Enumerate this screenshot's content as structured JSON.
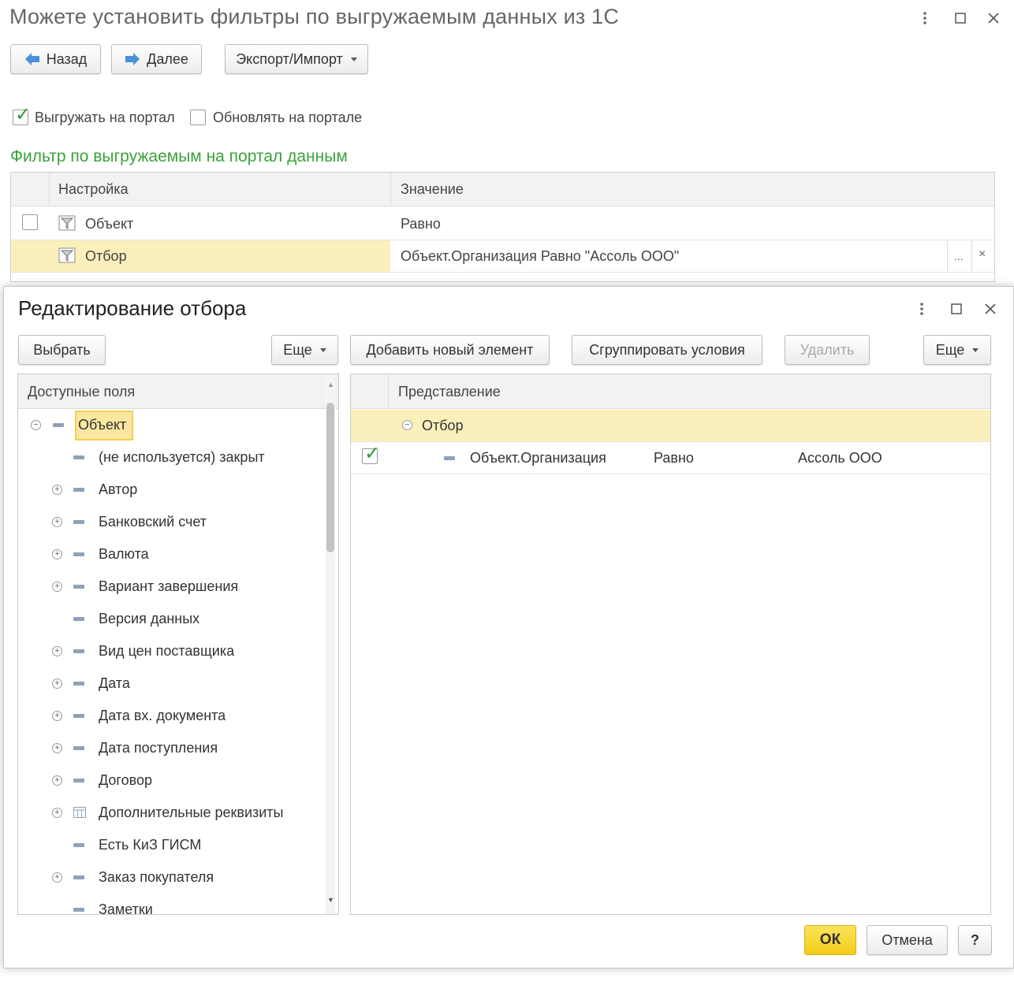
{
  "window": {
    "title": "Можете установить фильтры по выгружаемым данных из 1С",
    "menu_icon": "more-vertical-icon",
    "maximize_icon": "maximize-icon",
    "close_icon": "close-icon"
  },
  "toolbar": {
    "back_label": "Назад",
    "next_label": "Далее",
    "export_import_label": "Экспорт/Импорт"
  },
  "options": {
    "upload_label": "Выгружать на портал",
    "upload_checked": true,
    "update_label": "Обновлять на портале",
    "update_checked": false
  },
  "filter_section": {
    "title": "Фильтр по выгружаемым на портал данным",
    "columns": [
      "Настройка",
      "Значение"
    ],
    "rows": [
      {
        "name": "Объект",
        "value": "Равно"
      },
      {
        "name": "Отбор",
        "value": "Объект.Организация Равно \"Ассоль ООО\"",
        "ellipsis": "...",
        "clear": "×"
      }
    ]
  },
  "dialog": {
    "title": "Редактирование отбора",
    "select_label": "Выбрать",
    "more_left_label": "Еще",
    "add_label": "Добавить новый элемент",
    "group_label": "Сгруппировать условия",
    "delete_label": "Удалить",
    "more_right_label": "Еще",
    "available_header": "Доступные поля",
    "tree": [
      {
        "label": "Объект",
        "expand": "minus"
      },
      {
        "label": "(не используется) закрыт",
        "expand": "none"
      },
      {
        "label": "Автор",
        "expand": "plus"
      },
      {
        "label": "Банковский счет",
        "expand": "plus"
      },
      {
        "label": "Валюта",
        "expand": "plus"
      },
      {
        "label": "Вариант завершения",
        "expand": "plus"
      },
      {
        "label": "Версия данных",
        "expand": "none"
      },
      {
        "label": "Вид цен поставщика",
        "expand": "plus"
      },
      {
        "label": "Дата",
        "expand": "plus"
      },
      {
        "label": "Дата вх. документа",
        "expand": "plus"
      },
      {
        "label": "Дата поступления",
        "expand": "plus"
      },
      {
        "label": "Договор",
        "expand": "plus"
      },
      {
        "label": "Дополнительные реквизиты",
        "expand": "plus",
        "icon": "table-icon"
      },
      {
        "label": "Есть КиЗ ГИСМ",
        "expand": "none"
      },
      {
        "label": "Заказ покупателя",
        "expand": "plus"
      },
      {
        "label": "Заметки",
        "expand": "none"
      }
    ],
    "presentation_header": "Представление",
    "filter_group_label": "Отбор",
    "condition": {
      "field": "Объект.Организация",
      "comparison": "Равно",
      "value": "Ассоль ООО",
      "checked": true
    },
    "ok_label": "ОК",
    "cancel_label": "Отмена",
    "help_label": "?"
  },
  "colors": {
    "accent_green": "#3aa23a",
    "selection_yellow": "#fbefbc",
    "ok_yellow": "#f1cc18"
  }
}
